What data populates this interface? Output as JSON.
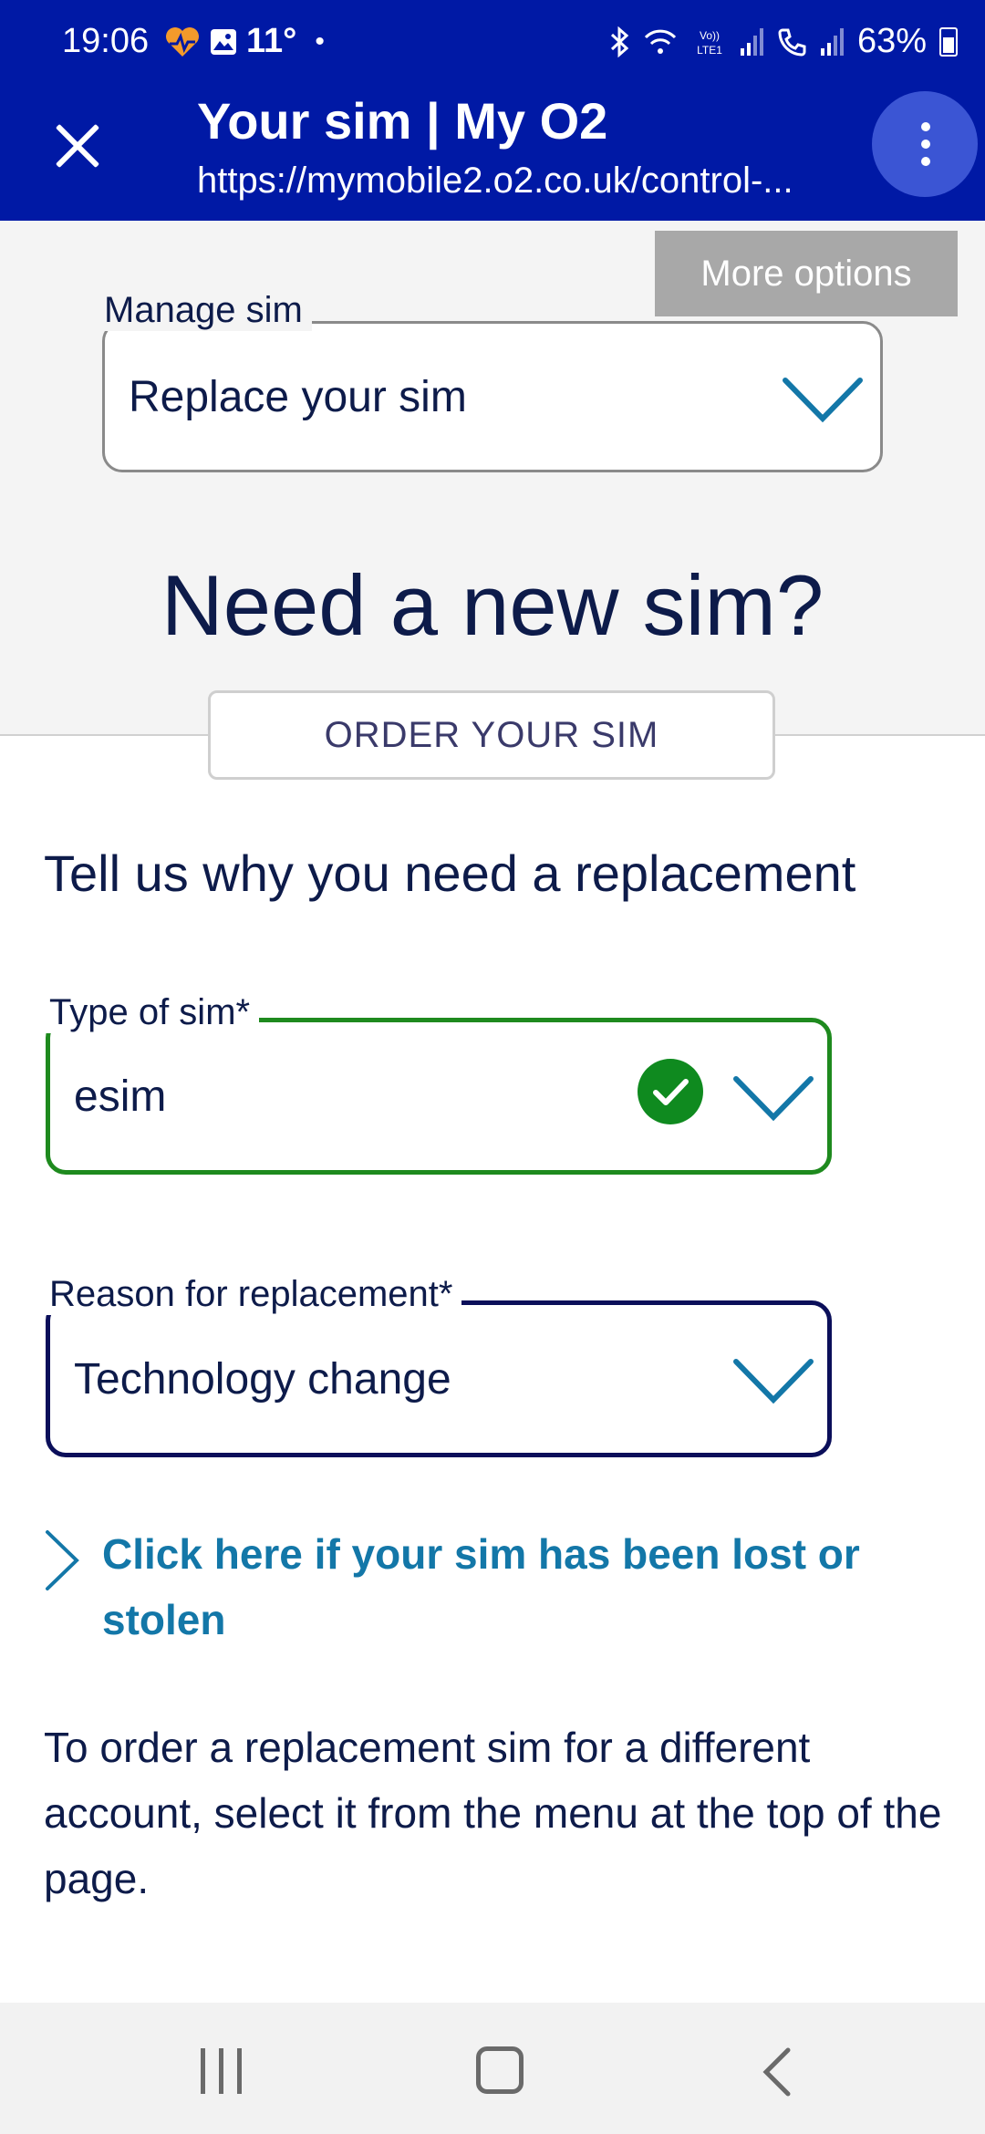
{
  "status_bar": {
    "time": "19:06",
    "temperature": "11°",
    "battery": "63%"
  },
  "browser": {
    "title": "Your sim | My O2",
    "url": "https://mymobile2.o2.co.uk/control-..."
  },
  "more_options_label": "More options",
  "manage_sim": {
    "legend": "Manage sim",
    "value": "Replace your sim"
  },
  "hero": {
    "heading": "Need a new sim?",
    "order_button": "ORDER YOUR SIM"
  },
  "form": {
    "subheading": "Tell us why you need a replacement",
    "type_of_sim": {
      "legend": "Type of sim*",
      "value": "esim"
    },
    "reason": {
      "legend": "Reason for replacement*",
      "value": "Technology change"
    },
    "lost_link": "Click here if your sim has been lost or stolen",
    "info": "To order a replacement sim for a different account, select it from the menu at the top of the page."
  },
  "colors": {
    "header_blue": "#0019a5",
    "valid_green": "#1e8a1e",
    "navy": "#0d1b4a",
    "link_blue": "#1377a8"
  }
}
